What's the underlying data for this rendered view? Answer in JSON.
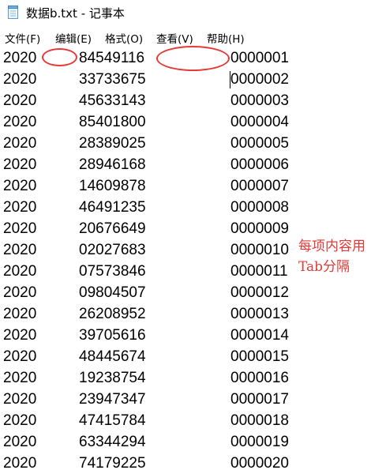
{
  "window": {
    "title": "数据b.txt - 记事本"
  },
  "menu": [
    {
      "label": "文件(F)"
    },
    {
      "label": "编辑(E)"
    },
    {
      "label": "格式(O)"
    },
    {
      "label": "查看(V)"
    },
    {
      "label": "帮助(H)"
    }
  ],
  "rows": [
    {
      "year": "2020",
      "number": "84549116",
      "id": "0000001"
    },
    {
      "year": "2020",
      "number": "33733675",
      "id": "0000002"
    },
    {
      "year": "2020",
      "number": "45633143",
      "id": "0000003"
    },
    {
      "year": "2020",
      "number": "85401800",
      "id": "0000004"
    },
    {
      "year": "2020",
      "number": "28389025",
      "id": "0000005"
    },
    {
      "year": "2020",
      "number": "28946168",
      "id": "0000006"
    },
    {
      "year": "2020",
      "number": "14609878",
      "id": "0000007"
    },
    {
      "year": "2020",
      "number": "46491235",
      "id": "0000008"
    },
    {
      "year": "2020",
      "number": "20676649",
      "id": "0000009"
    },
    {
      "year": "2020",
      "number": "02027683",
      "id": "0000010"
    },
    {
      "year": "2020",
      "number": "07573846",
      "id": "0000011"
    },
    {
      "year": "2020",
      "number": "09804507",
      "id": "0000012"
    },
    {
      "year": "2020",
      "number": "26208952",
      "id": "0000013"
    },
    {
      "year": "2020",
      "number": "39705616",
      "id": "0000014"
    },
    {
      "year": "2020",
      "number": "48445674",
      "id": "0000015"
    },
    {
      "year": "2020",
      "number": "19238754",
      "id": "0000016"
    },
    {
      "year": "2020",
      "number": "23947347",
      "id": "0000017"
    },
    {
      "year": "2020",
      "number": "47415784",
      "id": "0000018"
    },
    {
      "year": "2020",
      "number": "63344294",
      "id": "0000019"
    },
    {
      "year": "2020",
      "number": "74179225",
      "id": "0000020"
    }
  ],
  "annotation": {
    "line1": "每项内容用",
    "line2": "Tab分隔"
  },
  "colors": {
    "annotation": "#e53935"
  }
}
